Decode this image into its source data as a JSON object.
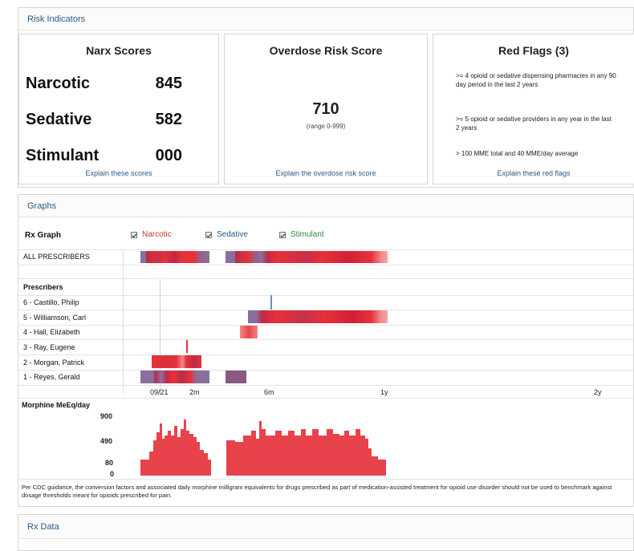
{
  "risk": {
    "header": "Risk Indicators",
    "narx": {
      "title": "Narx Scores",
      "rows": [
        {
          "label": "Narcotic",
          "value": "845"
        },
        {
          "label": "Sedative",
          "value": "582"
        },
        {
          "label": "Stimulant",
          "value": "000"
        }
      ],
      "link": "Explain these scores"
    },
    "overdose": {
      "title": "Overdose Risk Score",
      "score": "710",
      "range": "(range 0-999)",
      "link": "Explain the overdose risk score"
    },
    "flags": {
      "title": "Red Flags (3)",
      "items": [
        ">= 4 opioid or sedative dispensing pharmacies in any 90 day period in the last 2 years",
        ">= 5 opioid or sedative providers in any year in the last 2 years",
        "> 100 MME total and 40 MME/day average"
      ],
      "link": "Explain these red flags"
    }
  },
  "graphs": {
    "header": "Graphs",
    "rx_graph_label": "Rx Graph",
    "legend": [
      {
        "label": "Narcotic",
        "color": "#c0392b"
      },
      {
        "label": "Sedative",
        "color": "#2b5a86"
      },
      {
        "label": "Stimulant",
        "color": "#2e8b3a"
      }
    ],
    "all_prescribers": "ALL PRESCRIBERS",
    "prescribers_label": "Prescribers",
    "prescribers": [
      "6 - Castillo, Philip",
      "5 - Williamson, Carl",
      "4 - Hall, Elizabeth",
      "3 - Ray, Eugene",
      "2 - Morgan, Patrick",
      "1 - Reyes, Gerald"
    ],
    "time_ticks": [
      "09/21",
      "2m",
      "6m",
      "1y",
      "2y"
    ],
    "mme_label": "Morphine MeEq/day",
    "mme_ticks": [
      "900",
      "490",
      "80",
      "0"
    ],
    "note": "Per CDC guidance, the conversion factors and associated daily morphine milligram equivalents for drugs prescribed as part of medication-assisted treatment for opioid use disorder should not be used to benchmark against dosage thresholds meant for opioids prescribed for pain."
  },
  "rxdata": {
    "header": "Rx Data"
  },
  "colors": {
    "narcotic": "#e8303a",
    "sedative": "#8a6f9e",
    "mixed": "#a8364a",
    "link": "#2b5a86"
  }
}
